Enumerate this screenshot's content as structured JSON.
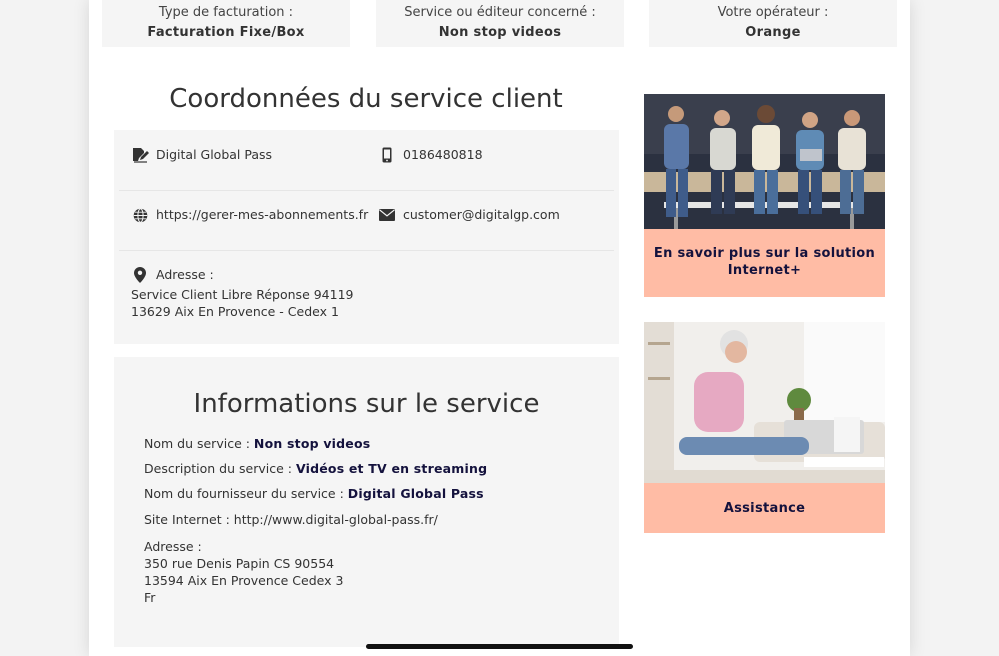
{
  "top_boxes": [
    {
      "label": "Type de facturation :",
      "value": "Facturation Fixe/Box"
    },
    {
      "label": "Service ou éditeur concerné :",
      "value": "Non stop videos"
    },
    {
      "label": "Votre opérateur :",
      "value": "Orange"
    }
  ],
  "contact": {
    "title": "Coordonnées du service client",
    "company": "Digital Global Pass",
    "phone": "0186480818",
    "website": "https://gerer-mes-abonnements.fr",
    "email": "customer@digitalgp.com",
    "address_label": "Adresse :",
    "address_line1": "Service Client Libre Réponse 94119",
    "address_line2": "13629 Aix En Provence - Cedex 1"
  },
  "service_info": {
    "title": "Informations sur le service",
    "name_label": "Nom du service : ",
    "name_value": "Non stop videos",
    "desc_label": "Description du service : ",
    "desc_value": "Vidéos et TV en streaming",
    "provider_label": "Nom du fournisseur du service : ",
    "provider_value": "Digital Global Pass",
    "site_label": "Site Internet : ",
    "site_value": "http://www.digital-global-pass.fr/",
    "address_label": "Adresse :",
    "address_line1": "350 rue Denis Papin CS 90554",
    "address_line2": "13594 Aix En Provence Cedex 3",
    "address_line3": "Fr"
  },
  "promos": [
    {
      "cta": "En savoir plus sur la solution Internet+",
      "image": "group-on-devices-photo"
    },
    {
      "cta": "Assistance",
      "image": "woman-on-phone-photo"
    }
  ],
  "colors": {
    "accent": "#ffbca5",
    "dark_text": "#14123d",
    "box_bg": "#f5f5f5"
  },
  "icons": {
    "company": "signature-icon",
    "phone": "mobile-phone-icon",
    "website": "globe-icon",
    "email": "envelope-icon",
    "address": "map-pin-icon"
  }
}
